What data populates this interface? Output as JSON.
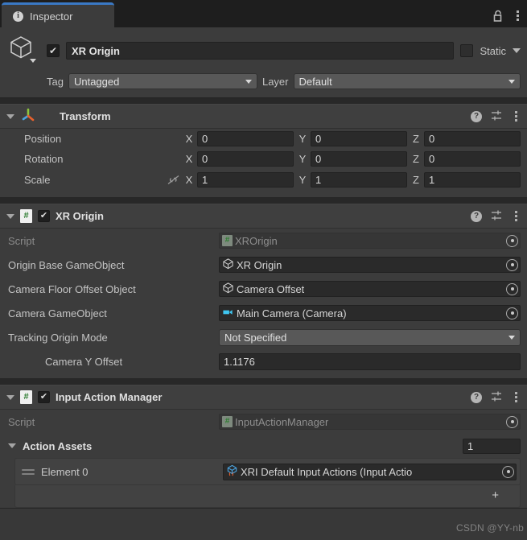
{
  "window": {
    "tab": {
      "label": "Inspector",
      "icon": "info-icon"
    },
    "lock_icon": "padlock-unlocked-icon",
    "menu_icon": "kebab-menu-icon",
    "accent_color": "#3a79c5",
    "background": "#383838"
  },
  "gameobject": {
    "icon": "cube-icon",
    "enabled": true,
    "check_glyph": "✔",
    "name": "XR Origin",
    "static_label": "Static",
    "static_checked": false,
    "tag_label": "Tag",
    "tag_value": "Untagged",
    "layer_label": "Layer",
    "layer_value": "Default"
  },
  "components": [
    {
      "title": "Transform",
      "icon": "transform-gizmo-icon",
      "has_checkbox": false,
      "rows": [
        {
          "label": "Position",
          "x": "0",
          "y": "0",
          "z": "0",
          "link": false
        },
        {
          "label": "Rotation",
          "x": "0",
          "y": "0",
          "z": "0",
          "link": false
        },
        {
          "label": "Scale",
          "x": "1",
          "y": "1",
          "z": "1",
          "link": true
        }
      ],
      "axis_labels": {
        "x": "X",
        "y": "Y",
        "z": "Z"
      }
    },
    {
      "title": "XR Origin",
      "icon": "cs-script-icon",
      "has_checkbox": true,
      "check_glyph": "✔",
      "fields": [
        {
          "label": "Script",
          "value": "XROrigin",
          "icon": "cs-script-icon",
          "disabled": true,
          "kind": "object"
        },
        {
          "label": "Origin Base GameObject",
          "value": "XR Origin",
          "icon": "cube-icon",
          "disabled": false,
          "kind": "object"
        },
        {
          "label": "Camera Floor Offset Object",
          "value": "Camera Offset",
          "icon": "cube-icon",
          "disabled": false,
          "kind": "object"
        },
        {
          "label": "Camera GameObject",
          "value": "Main Camera (Camera)",
          "icon": "camera-icon",
          "disabled": false,
          "kind": "object"
        },
        {
          "label": "Tracking Origin Mode",
          "value": "Not Specified",
          "kind": "dropdown"
        },
        {
          "label": "Camera Y Offset",
          "value": "1.1176",
          "kind": "text"
        }
      ]
    },
    {
      "title": "Input Action Manager",
      "icon": "cs-script-icon",
      "has_checkbox": true,
      "check_glyph": "✔",
      "script_label": "Script",
      "script_value": "InputActionManager",
      "array": {
        "label": "Action Assets",
        "size": "1",
        "elements": [
          {
            "label": "Element 0",
            "value": "XRI Default Input Actions (Input Actio",
            "icon": "input-actions-asset-icon"
          }
        ],
        "add_glyph": "+"
      }
    }
  ],
  "component_header_icons": {
    "help": "help-icon",
    "preset": "preset-icon",
    "menu": "kebab-menu-icon"
  },
  "watermark": "CSDN @YY-nb"
}
